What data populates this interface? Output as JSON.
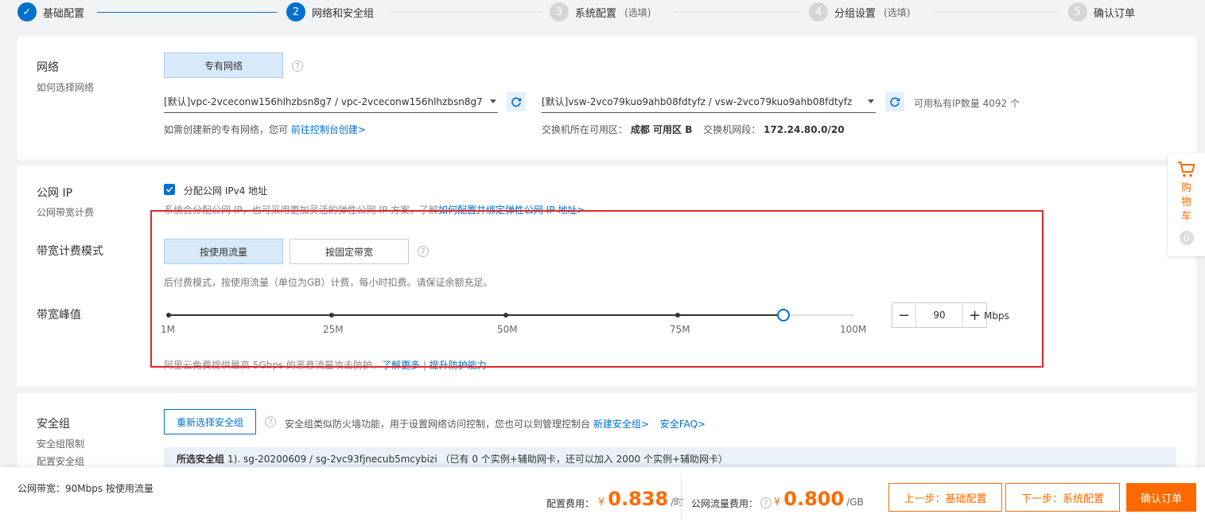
{
  "steps": [
    {
      "num": "✓",
      "label": "基础配置",
      "optional": ""
    },
    {
      "num": "2",
      "label": "网络和安全组",
      "optional": ""
    },
    {
      "num": "3",
      "label": "系统配置",
      "optional": "(选填)"
    },
    {
      "num": "4",
      "label": "分组设置",
      "optional": "(选填)"
    },
    {
      "num": "5",
      "label": "确认订单",
      "optional": ""
    }
  ],
  "network": {
    "title": "网络",
    "subtitle": "如何选择网络",
    "type_button": "专有网络",
    "vpc_select": "[默认]vpc-2vceconw156hlhzbsn8g7 / vpc-2vceconw156hlhzbsn8g7",
    "vsw_select": "[默认]vsw-2vco79kuo9ahb08fdtyfz / vsw-2vco79kuo9ahb08fdtyfz",
    "available_ip": "可用私有IP数量 4092 个",
    "create_hint": "如需创建新的专有网络，您可",
    "create_link": "前往控制台创建>",
    "zone_label": "交换机所在可用区：",
    "zone_value": "成都 可用区 B",
    "cidr_label": "交换机网段：",
    "cidr_value": "172.24.80.0/20"
  },
  "public_ip": {
    "title": "公网 IP",
    "subtitle": "公网带宽计费",
    "checkbox_label": "分配公网 IPv4 地址",
    "hint": "系统会分配公网 IP，也可采用更加灵活的弹性公网 IP 方案，了解",
    "hint_link": "如何配置并绑定弹性公网 IP 地址>",
    "billing_title": "带宽计费模式",
    "billing_by_traffic": "按使用流量",
    "billing_fixed": "按固定带宽",
    "billing_hint": "后付费模式，按使用流量（单位为GB）计费，每小时扣费。请保证余额充足。",
    "peak_title": "带宽峰值",
    "ticks": [
      "1M",
      "25M",
      "50M",
      "75M",
      "100M"
    ],
    "slider_min": 1,
    "slider_max": 100,
    "bandwidth_value": "90",
    "unit": "Mbps",
    "ddos_hint": "阿里云免费提供最高 5Gbps 的恶意流量攻击防护，",
    "ddos_link1": "了解更多",
    "ddos_sep": "|",
    "ddos_link2": "提升防护能力"
  },
  "security": {
    "title": "安全组",
    "subtitle1": "安全组限制",
    "subtitle2": "配置安全组",
    "reselect_button": "重新选择安全组",
    "hint": "安全组类似防火墙功能，用于设置网络访问控制，您也可以到管理控制台",
    "link1": "新建安全组>",
    "link2": "安全FAQ>",
    "selected_label": "所选安全组",
    "selected_value": "1). sg-20200609 / sg-2vc93fjnecub5mcybizi （已有 0 个实例+辅助网卡，还可以加入 2000 个实例+辅助网卡）"
  },
  "cart": {
    "label": "购物车",
    "count": "0"
  },
  "footer": {
    "summary": "公网带宽：90Mbps 按使用流量",
    "config_fee_label": "配置费用：",
    "currency": "¥",
    "config_fee": "0.838",
    "config_unit": "/时",
    "traffic_fee_label": "公网流量费用：",
    "traffic_fee": "0.800",
    "traffic_unit": "/GB",
    "prev_button": "上一步：基础配置",
    "next_button": "下一步：系统配置",
    "confirm_button": "确认订单"
  },
  "colors": {
    "primary": "#0070cc",
    "accent": "#ff6a00",
    "highlight": "#e0282f"
  }
}
